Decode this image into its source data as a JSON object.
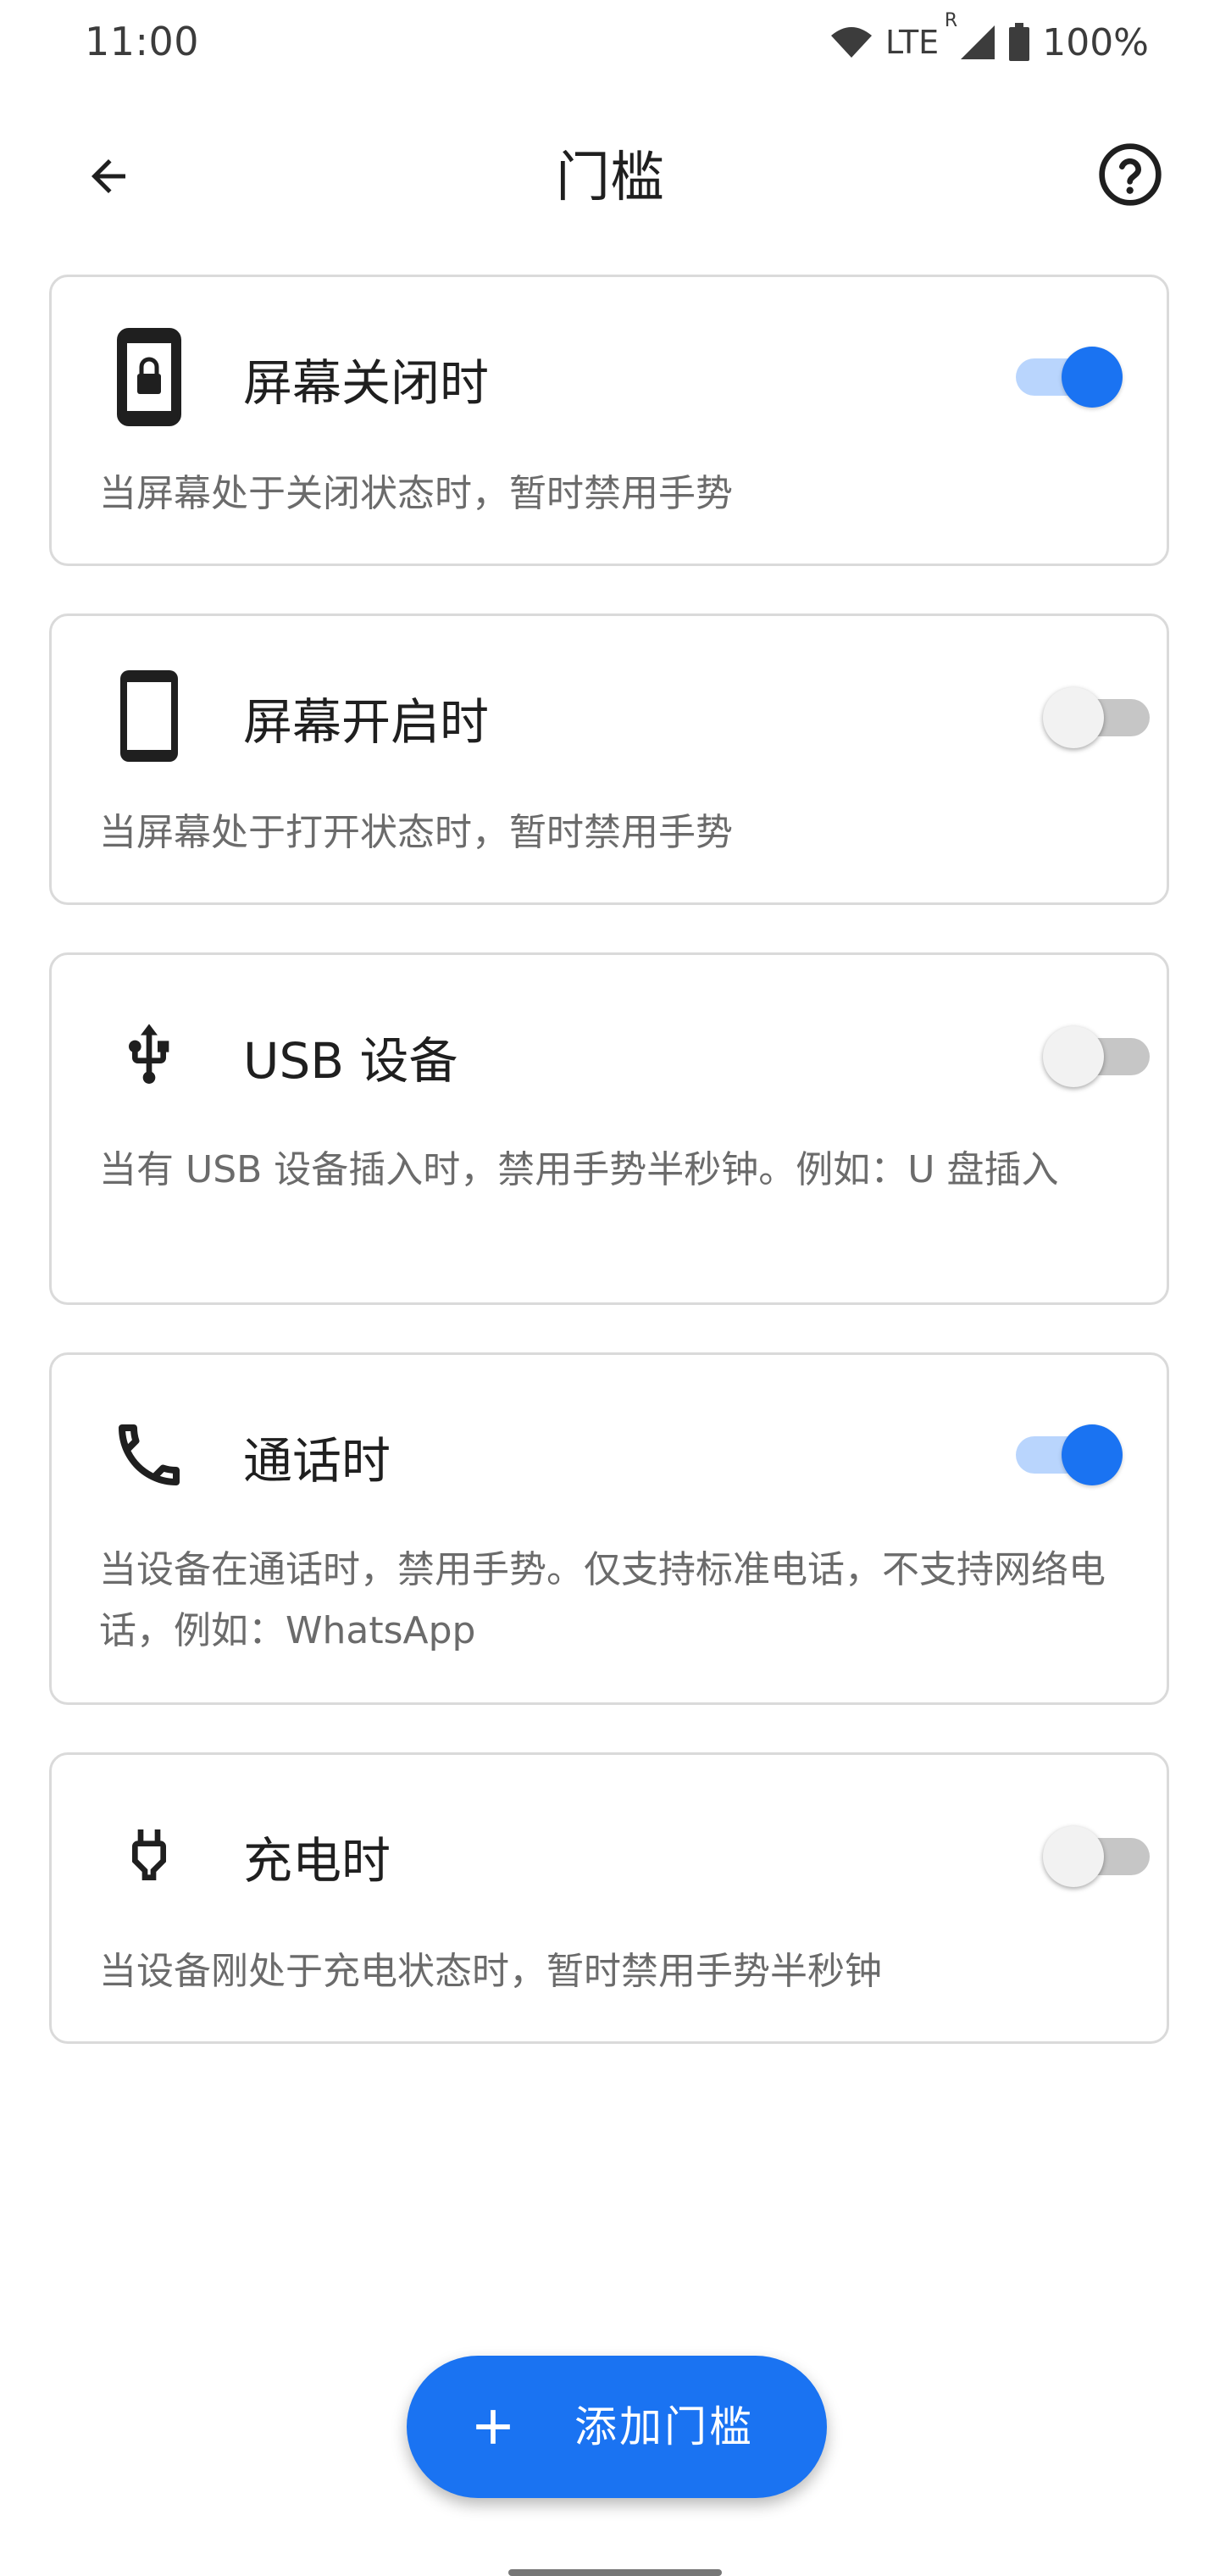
{
  "status_bar": {
    "time": "11:00",
    "network": "LTE",
    "roaming": "R",
    "battery": "100%"
  },
  "app_bar": {
    "title": "门槛",
    "back_icon": "arrow-back-icon",
    "help_icon": "help-circle-icon"
  },
  "cards": [
    {
      "title": "屏幕关闭时",
      "description": "当屏幕处于关闭状态时，暂时禁用手势",
      "icon": "phone-lock-icon",
      "enabled": true
    },
    {
      "title": "屏幕开启时",
      "description": "当屏幕处于打开状态时，暂时禁用手势",
      "icon": "smartphone-icon",
      "enabled": false
    },
    {
      "title": "USB 设备",
      "description": "当有 USB 设备插入时，禁用手势半秒钟。例如：U 盘插入",
      "icon": "usb-icon",
      "enabled": false
    },
    {
      "title": "通话时",
      "description": "当设备在通话时，禁用手势。仅支持标准电话，不支持网络电话，例如：WhatsApp",
      "icon": "phone-call-icon",
      "enabled": true
    },
    {
      "title": "充电时",
      "description": "当设备刚处于充电状态时，暂时禁用手势半秒钟",
      "icon": "power-plug-icon",
      "enabled": false
    }
  ],
  "fab": {
    "label": "添加门槛",
    "icon": "plus-icon"
  },
  "colors": {
    "accent": "#1a73f2",
    "switch_on_track": "#b9d5fd",
    "switch_off_track": "#c6c6c6",
    "card_border": "#dadada",
    "description_text": "#6b6b6b"
  }
}
